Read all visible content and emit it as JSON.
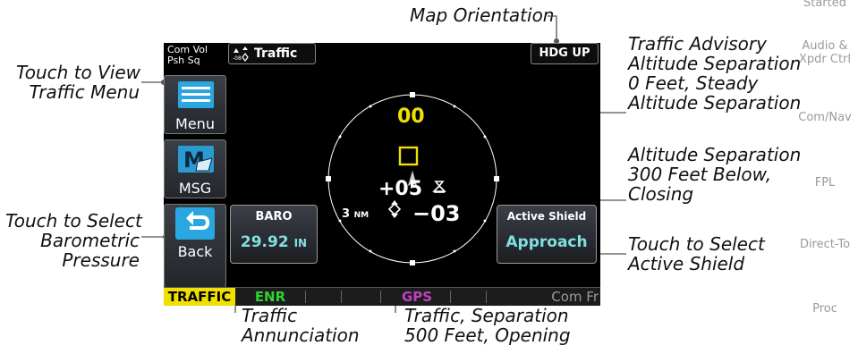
{
  "callouts": {
    "map_orientation": "Map Orientation",
    "view_menu": [
      "Touch to View",
      "Traffic Menu"
    ],
    "barometric": [
      "Touch to Select",
      "Barometric",
      "Pressure"
    ],
    "traffic_advisory": [
      "Traffic Advisory",
      "Altitude Separation",
      "0 Feet, Steady",
      "Altitude Separation"
    ],
    "sep_300": [
      "Altitude Separation",
      "300 Feet Below,",
      "Closing"
    ],
    "active_shield": [
      "Touch to Select",
      "Active Shield"
    ],
    "annunciation": [
      "Traffic",
      "Annunciation"
    ],
    "sep_500": [
      "Traffic, Separation",
      "500 Feet, Opening"
    ]
  },
  "side_tabs": [
    "Started",
    "Audio &",
    "Xpdr Ctrl",
    "Com/Nav",
    "FPL",
    "Direct-To",
    "Proc"
  ],
  "screen": {
    "com_vol": [
      "Com Vol",
      "Psh Sq"
    ],
    "page_title": "Traffic",
    "orientation_button": "HDG UP",
    "menu_button": "Menu",
    "msg_button": "MSG",
    "back_button": "Back",
    "baro_label": "BARO",
    "baro_value": "29.92",
    "baro_unit": "IN",
    "shield_label": "Active Shield",
    "shield_value": "Approach",
    "traffic_top_alt": "00",
    "traffic_plus": "+05",
    "traffic_minus": "−03",
    "range": "3",
    "range_unit": "NM",
    "annunciation_bar": {
      "traffic": "TRAFFIC",
      "enr": "ENR",
      "gps": "GPS",
      "com": "Com Fr"
    }
  },
  "colors": {
    "traffic_yellow": "#f0e000",
    "teal_text": "#7fe0e0",
    "enr_green": "#30d030",
    "gps_magenta": "#c040c0"
  }
}
